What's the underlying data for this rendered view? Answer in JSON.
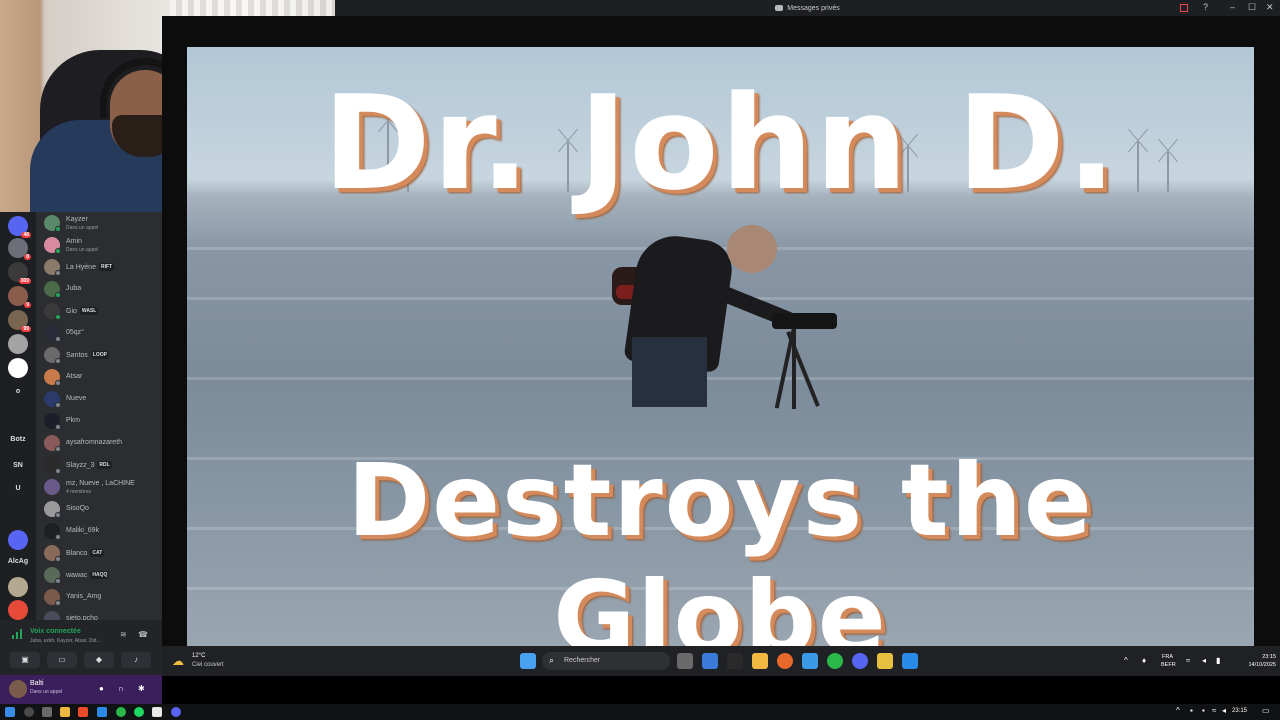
{
  "window": {
    "title": "Messages privés",
    "controls": [
      "–",
      "☐",
      "✕"
    ]
  },
  "servers": [
    {
      "badge": "48",
      "color": "#5865f2"
    },
    {
      "badge": "8",
      "color": "#6d6f78"
    },
    {
      "badge": "300",
      "color": "#3a3a3a"
    },
    {
      "badge": "9",
      "color": "#8a5c4c"
    },
    {
      "badge": "99",
      "color": "#7a6650"
    },
    {
      "badge": "",
      "color": "#a3a3a3"
    },
    {
      "badge": "",
      "color": "#ffffff"
    }
  ],
  "server_texts": [
    "o",
    "Botz",
    "SN",
    "U",
    "AlcAg"
  ],
  "dms": [
    {
      "name": "Kayzer",
      "sub": "Dans un appel",
      "tag": "",
      "color": "#5a8a6a",
      "status": "#23a55a"
    },
    {
      "name": "Amin",
      "sub": "Dans un appel",
      "tag": "",
      "color": "#d88aa0",
      "status": "#23a55a"
    },
    {
      "name": "La Hyène",
      "sub": "",
      "tag": "RIFT",
      "color": "#8a7a6a",
      "status": "#80848e"
    },
    {
      "name": "Juba",
      "sub": "",
      "tag": "",
      "color": "#4a6a4a",
      "status": "#23a55a"
    },
    {
      "name": "Gio",
      "sub": "",
      "tag": "WASL",
      "color": "#3a3a3a",
      "status": "#23a55a"
    },
    {
      "name": "05qz°",
      "sub": "",
      "tag": "",
      "color": "#2a2a3a",
      "status": "#80848e"
    },
    {
      "name": "Santos",
      "sub": "",
      "tag": "LOOP",
      "color": "#6a6a6a",
      "status": "#80848e"
    },
    {
      "name": "Atsar",
      "sub": "",
      "tag": "",
      "color": "#c87a4a",
      "status": "#80848e"
    },
    {
      "name": "Nueve",
      "sub": "",
      "tag": "",
      "color": "#2a3a6a",
      "status": "#80848e"
    },
    {
      "name": "Pkm",
      "sub": "",
      "tag": "",
      "color": "#1e1e2a",
      "status": "#80848e"
    },
    {
      "name": "aysafromnazareth",
      "sub": "",
      "tag": "",
      "color": "#8a5a5a",
      "status": "#80848e"
    },
    {
      "name": "Slayzz_3",
      "sub": "",
      "tag": "RDL",
      "color": "#2a2a2a",
      "status": "#80848e"
    },
    {
      "name": "mz, Nueve , LaCHINE",
      "sub": "4 membres",
      "tag": "",
      "color": "#6a5a8a",
      "status": ""
    },
    {
      "name": "SisoQo",
      "sub": "",
      "tag": "",
      "color": "#9a9a9a",
      "status": "#80848e"
    },
    {
      "name": "Maliki_69k",
      "sub": "",
      "tag": "",
      "color": "#1e1f22",
      "status": "#80848e"
    },
    {
      "name": "Blanco",
      "sub": "",
      "tag": "CAT",
      "color": "#8a6a5a",
      "status": "#80848e"
    },
    {
      "name": "wawac",
      "sub": "",
      "tag": "HAQQ",
      "color": "#5a6a5a",
      "status": "#80848e"
    },
    {
      "name": "Yanis_Amg",
      "sub": "",
      "tag": "",
      "color": "#7a5a4a",
      "status": "#80848e"
    },
    {
      "name": "sieto.pcho",
      "sub": "",
      "tag": "",
      "color": "#4a4a5a",
      "status": "#80848e"
    }
  ],
  "voice": {
    "title": "Voix connectée",
    "members": "Juba, ezkh, Kayzer, Atsar, Did..."
  },
  "user": {
    "name": "Balti",
    "status": "Dans un appel"
  },
  "video": {
    "title_top": "Dr. John D.",
    "title_bottom": "Destroys the Globe"
  },
  "taskbar": {
    "weather_temp": "12°C",
    "weather_desc": "Ciel couvert",
    "search_placeholder": "Rechercher",
    "lang": "FRA",
    "layout": "BEFR",
    "time": "23:15",
    "date": "14/10/2025"
  },
  "outer_taskbar": {
    "time": "23:15"
  }
}
